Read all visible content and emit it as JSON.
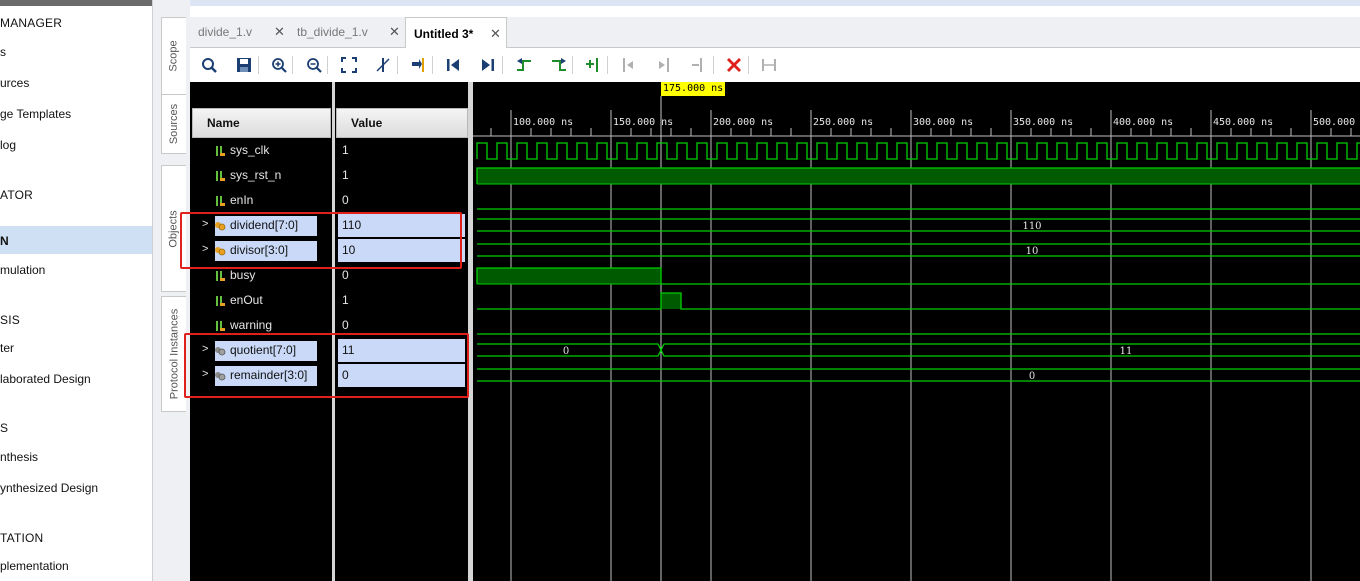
{
  "flow_navigator": {
    "items": [
      {
        "label": "MANAGER",
        "kind": "header"
      },
      {
        "label": "s",
        "kind": "item"
      },
      {
        "label": "urces",
        "kind": "item"
      },
      {
        "label": "ge Templates",
        "kind": "item"
      },
      {
        "label": "log",
        "kind": "item"
      },
      {
        "label": "ATOR",
        "kind": "header"
      },
      {
        "label": "N",
        "kind": "header-selected"
      },
      {
        "label": "mulation",
        "kind": "item"
      },
      {
        "label": "SIS",
        "kind": "header"
      },
      {
        "label": "ter",
        "kind": "item"
      },
      {
        "label": "laborated Design",
        "kind": "item"
      },
      {
        "label": "S",
        "kind": "header"
      },
      {
        "label": "nthesis",
        "kind": "item"
      },
      {
        "label": "ynthesized Design",
        "kind": "item"
      },
      {
        "label": "TATION",
        "kind": "header"
      },
      {
        "label": "plementation",
        "kind": "item"
      }
    ]
  },
  "side_tabs": [
    "Scope",
    "Sources",
    "Objects",
    "Protocol Instances"
  ],
  "tabs": [
    {
      "label": "divide_1.v",
      "active": false
    },
    {
      "label": "tb_divide_1.v",
      "active": false
    },
    {
      "label": "Untitled 3*",
      "active": true
    }
  ],
  "toolbar": {
    "buttons": [
      {
        "icon": "search-icon"
      },
      {
        "icon": "save-icon"
      },
      {
        "icon": "zoom-in-icon"
      },
      {
        "icon": "zoom-out-icon"
      },
      {
        "icon": "zoom-fit-icon"
      },
      {
        "icon": "cursor-off-icon"
      },
      {
        "icon": "go-to-cursor-icon"
      },
      {
        "icon": "go-to-start-icon"
      },
      {
        "icon": "go-to-end-icon"
      },
      {
        "icon": "previous-transition-icon"
      },
      {
        "icon": "next-transition-icon"
      },
      {
        "icon": "add-marker-icon"
      },
      {
        "icon": "previous-marker-icon"
      },
      {
        "icon": "next-marker-icon"
      },
      {
        "icon": "swap-cursors-icon"
      },
      {
        "icon": "delete-icon"
      },
      {
        "icon": "snap-icon"
      }
    ]
  },
  "wave": {
    "headers": {
      "name": "Name",
      "value": "Value"
    },
    "cursor_time": "175.000 ns",
    "time_ticks": [
      "100.000 ns",
      "150.000 ns",
      "200.000 ns",
      "250.000 ns",
      "300.000 ns",
      "350.000 ns",
      "400.000 ns",
      "450.000 ns",
      "500.000"
    ],
    "signals": [
      {
        "name": "sys_clk",
        "value": "1",
        "type": "bit",
        "selected": false
      },
      {
        "name": "sys_rst_n",
        "value": "1",
        "type": "bit",
        "selected": false
      },
      {
        "name": "enIn",
        "value": "0",
        "type": "bit",
        "selected": false
      },
      {
        "name": "dividend[7:0]",
        "value": "110",
        "type": "bus-in",
        "selected": true,
        "bus_values": [
          "110"
        ]
      },
      {
        "name": "divisor[3:0]",
        "value": "10",
        "type": "bus-in",
        "selected": true,
        "bus_values": [
          "10"
        ]
      },
      {
        "name": "busy",
        "value": "0",
        "type": "bit",
        "selected": false
      },
      {
        "name": "enOut",
        "value": "1",
        "type": "bit",
        "selected": false
      },
      {
        "name": "warning",
        "value": "0",
        "type": "bit",
        "selected": false
      },
      {
        "name": "quotient[7:0]",
        "value": "11",
        "type": "bus-out",
        "selected": true,
        "bus_values": [
          "0",
          "11"
        ]
      },
      {
        "name": "remainder[3:0]",
        "value": "0",
        "type": "bus-out",
        "selected": true,
        "bus_values": [
          "0"
        ]
      }
    ]
  },
  "colors": {
    "wave_green": "#00d000",
    "wave_fill": "#005a00",
    "highlight": "#e0201b",
    "cursor_label_bg": "#ffff00"
  }
}
